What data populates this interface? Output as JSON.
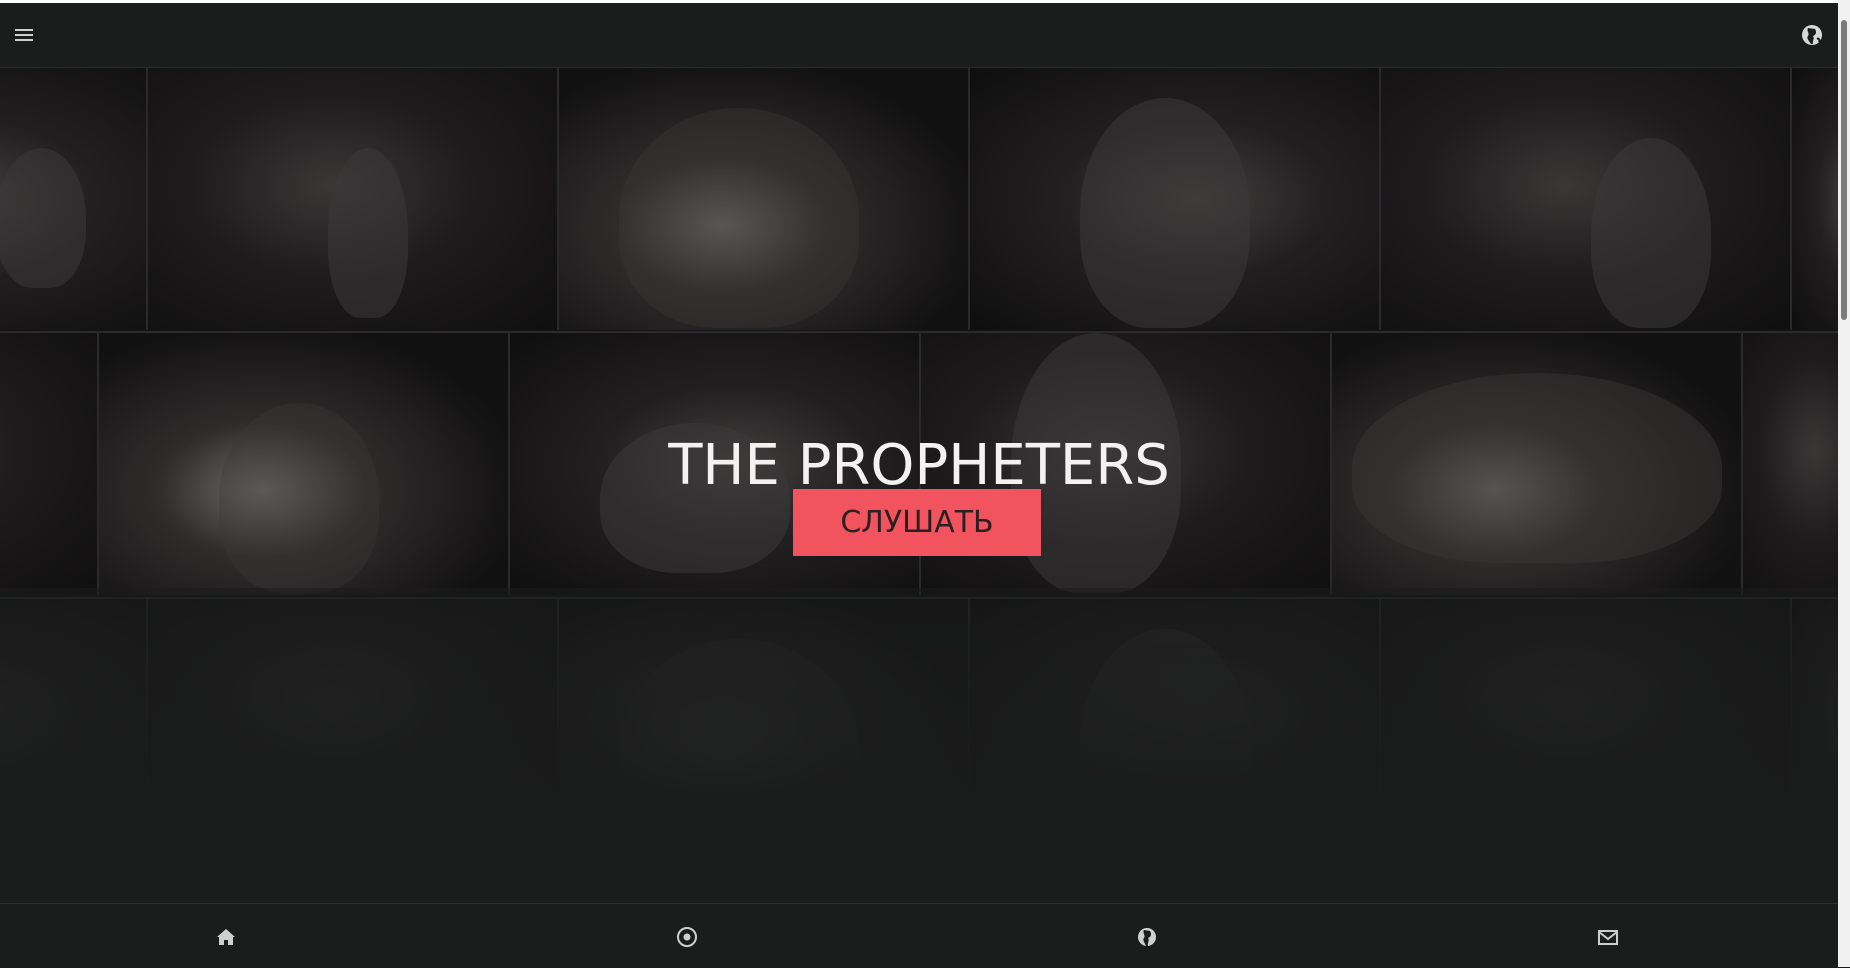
{
  "brand_colors": {
    "accent": "#f2545f",
    "background": "#1a1b1b",
    "bar": "#1b1c1c"
  },
  "header": {
    "menu_icon": "hamburger-menu-icon",
    "language_icon": "globe-icon"
  },
  "hero": {
    "title": "THE PROPHETERS",
    "listen_button": "СЛУШАТЬ"
  },
  "bottom_nav": {
    "items": [
      {
        "icon": "home-icon"
      },
      {
        "icon": "vinyl-disc-icon"
      },
      {
        "icon": "globe-icon"
      },
      {
        "icon": "mail-icon"
      }
    ]
  }
}
